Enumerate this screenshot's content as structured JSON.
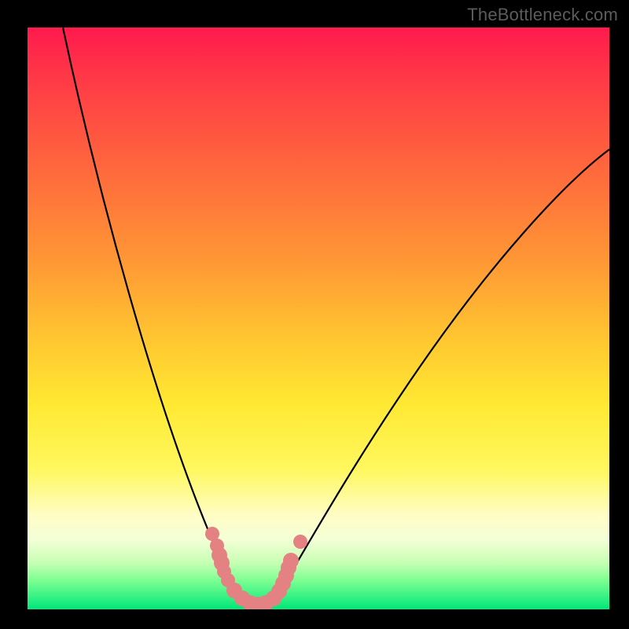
{
  "attribution": "TheBottleneck.com",
  "chart_data": {
    "type": "line",
    "title": "",
    "xlabel": "",
    "ylabel": "",
    "xlim": [
      0,
      100
    ],
    "ylim": [
      0,
      100
    ],
    "series": [
      {
        "name": "bottleneck-curve",
        "x": [
          5,
          8,
          12,
          16,
          20,
          24,
          27,
          29,
          31,
          33,
          35,
          37,
          39,
          41,
          43,
          47,
          52,
          58,
          65,
          73,
          82,
          92,
          100
        ],
        "y": [
          100,
          90,
          78,
          65,
          53,
          40,
          30,
          22,
          15,
          9,
          5,
          2,
          1,
          2,
          5,
          11,
          19,
          28,
          36,
          44,
          52,
          59,
          65
        ]
      }
    ],
    "good_zone_markers_x": [
      29,
      30,
      31,
      33,
      34,
      35,
      36,
      37,
      38,
      39,
      40,
      41,
      42
    ],
    "marker_color": "#e48182",
    "curve_color": "#000000",
    "gradient_stops": [
      {
        "pos": 0.0,
        "color": "#ff1a4d"
      },
      {
        "pos": 0.55,
        "color": "#ffcb30"
      },
      {
        "pos": 0.85,
        "color": "#fffdc7"
      },
      {
        "pos": 1.0,
        "color": "#00e77a"
      }
    ]
  }
}
